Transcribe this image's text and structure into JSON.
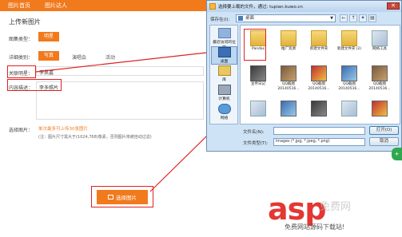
{
  "topnav": {
    "items": [
      "图片首页",
      "图片达人"
    ]
  },
  "page": {
    "title": "上传新图片"
  },
  "form": {
    "type_label": "图集类型：",
    "type_value": "明星",
    "detail_label": "详细类别：",
    "detail_options": [
      "写真",
      "演唱会",
      "活动"
    ],
    "star_label": "关联明星：",
    "star_value": "李昊嘉",
    "desc_label": "内容描述：",
    "desc_value": "李多照片",
    "image_label": "选择图片：",
    "hint_main": "单次最多可上传30张图片",
    "hint_note": "(注：图片尺寸需大于(1024,768)像素，否则图片将被自动过滤)",
    "select_button": "选择图片"
  },
  "dialog": {
    "title": "选择要上载的文件，通过: tupian.kuwo.cn",
    "close": "✕",
    "lookin_label": "保存在(I):",
    "lookin_value": "桌面",
    "places": [
      "最近访问的位置",
      "桌面",
      "库",
      "计算机",
      "网络"
    ],
    "files": [
      "Pandas",
      "推广资源",
      "新建文件夹",
      "新建文件夹 (2)",
      "网络工具",
      "宣传日记",
      "QQ截图 20140516...",
      "QQ截图 20140516...",
      "QQ截图 20140516...",
      "QQ截图 20140516...",
      "",
      "",
      "",
      "",
      ""
    ],
    "filename_label": "文件名(N):",
    "filetype_label": "文件类型(T):",
    "filetype_value": "Images (*.jpg, *.jpeg, *.png)",
    "open_button": "打开(O)",
    "cancel_button": "取消"
  },
  "side_badge": "+",
  "watermark": {
    "main": "asp",
    "cn": "免费网",
    "sub": "免费网站源码下载站!"
  }
}
